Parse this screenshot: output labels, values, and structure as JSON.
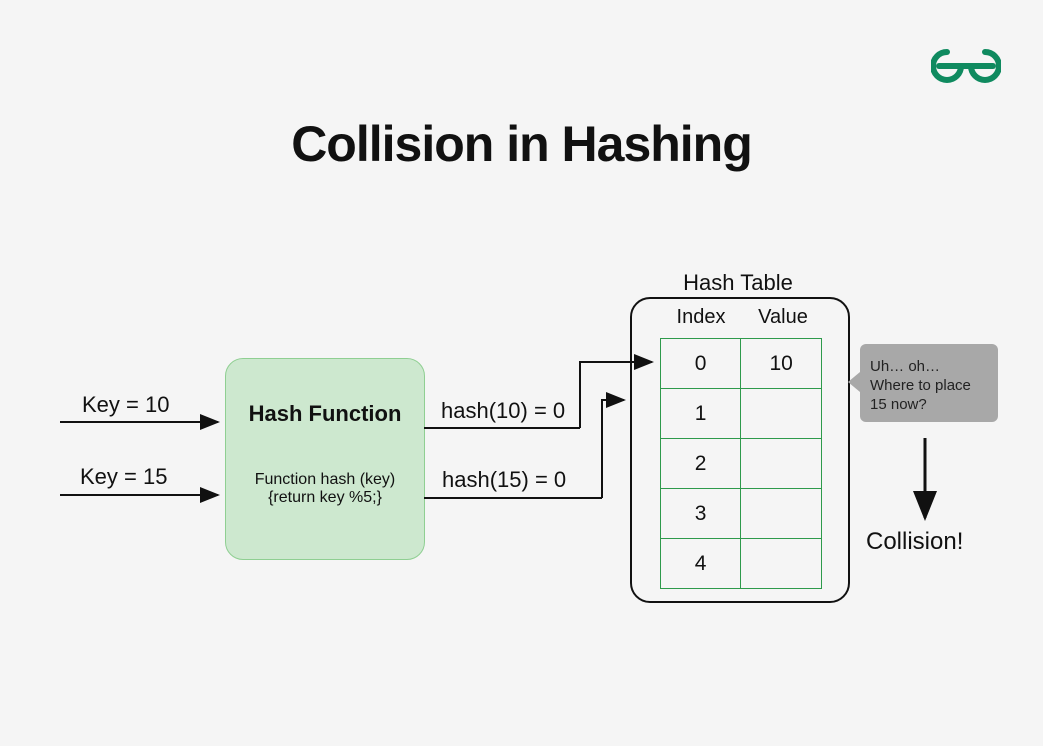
{
  "title": "Collision in Hashing",
  "keys": {
    "k1": "Key = 10",
    "k2": "Key = 15"
  },
  "hash_function": {
    "title": "Hash Function",
    "code_line1": "Function hash (key)",
    "code_line2": "{return key %5;}"
  },
  "hash_results": {
    "r1": "hash(10) = 0",
    "r2": "hash(15) = 0"
  },
  "hash_table": {
    "title": "Hash Table",
    "headers": {
      "index": "Index",
      "value": "Value"
    },
    "rows": [
      {
        "index": "0",
        "value": "10"
      },
      {
        "index": "1",
        "value": ""
      },
      {
        "index": "2",
        "value": ""
      },
      {
        "index": "3",
        "value": ""
      },
      {
        "index": "4",
        "value": ""
      }
    ]
  },
  "speech": "Uh… oh… Where to place 15 now?",
  "collision_label": "Collision!",
  "colors": {
    "brand_green": "#0f8a5f",
    "table_border": "#2e9a4b",
    "fn_bg": "#cde8cf",
    "speech_bg": "#a8a8a8"
  }
}
